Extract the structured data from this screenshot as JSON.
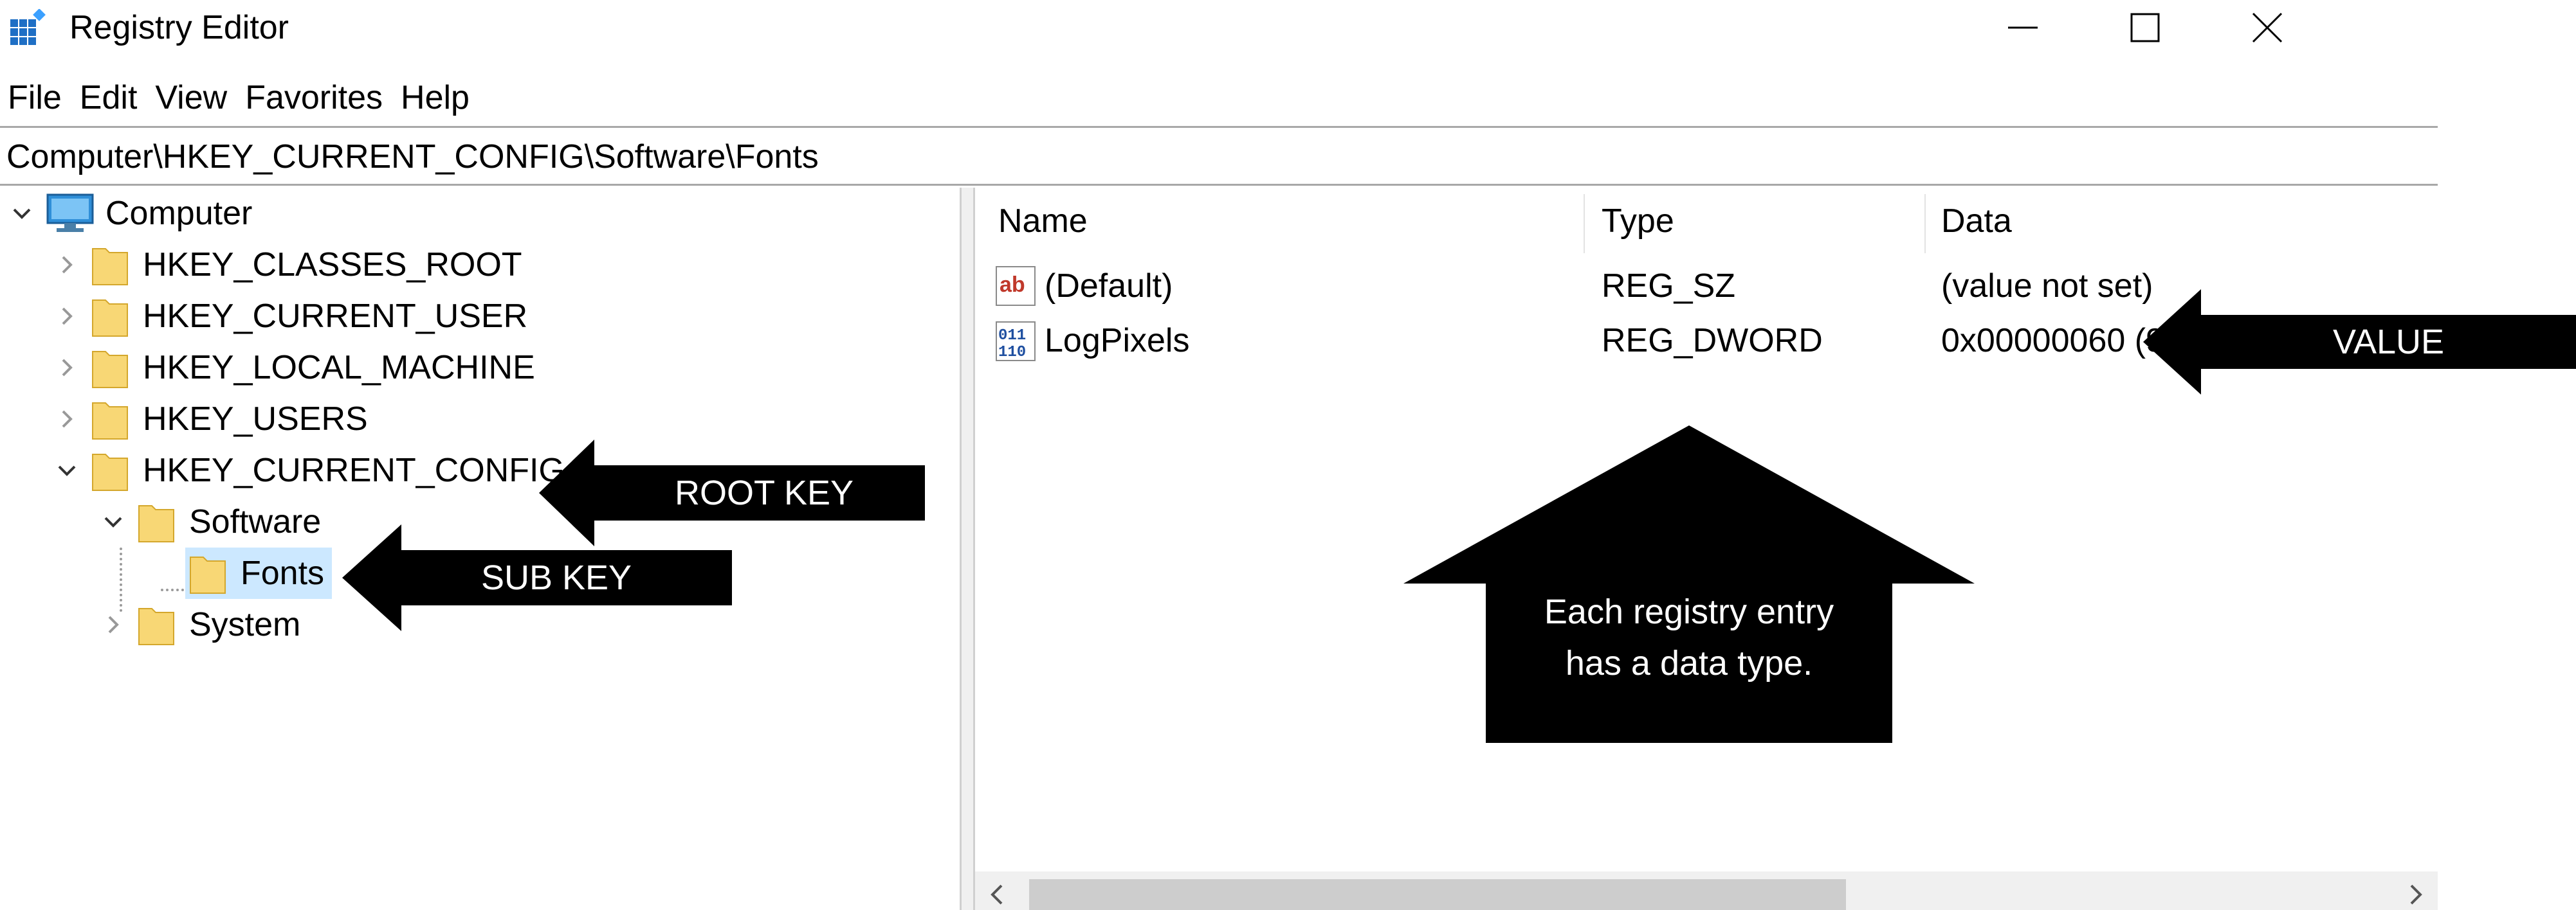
{
  "window": {
    "title": "Registry Editor",
    "controls": [
      "minimize",
      "maximize",
      "close"
    ]
  },
  "menu": [
    "File",
    "Edit",
    "View",
    "Favorites",
    "Help"
  ],
  "address": "Computer\\HKEY_CURRENT_CONFIG\\Software\\Fonts",
  "tree": {
    "root": "Computer",
    "items": [
      {
        "label": "HKEY_CLASSES_ROOT",
        "expanded": false
      },
      {
        "label": "HKEY_CURRENT_USER",
        "expanded": false
      },
      {
        "label": "HKEY_LOCAL_MACHINE",
        "expanded": false
      },
      {
        "label": "HKEY_USERS",
        "expanded": false
      },
      {
        "label": "HKEY_CURRENT_CONFIG",
        "expanded": true
      },
      {
        "label": "Software",
        "expanded": true
      },
      {
        "label": "Fonts",
        "selected": true
      },
      {
        "label": "System",
        "expanded": false
      }
    ]
  },
  "list": {
    "columns": [
      "Name",
      "Type",
      "Data"
    ],
    "rows": [
      {
        "name": "(Default)",
        "type": "REG_SZ",
        "data": "(value not set)",
        "icon": "string-value-icon"
      },
      {
        "name": "LogPixels",
        "type": "REG_DWORD",
        "data": "0x00000060 (96)",
        "icon": "binary-value-icon"
      }
    ]
  },
  "annotations": {
    "root_key": "ROOT KEY",
    "sub_key": "SUB KEY",
    "value": "VALUE",
    "data_type_line1": "Each registry entry",
    "data_type_line2": "has a data type."
  },
  "colors": {
    "selection": "#cce8ff",
    "folder": "#f8d775",
    "annotation": "#000000",
    "separator": "#a8a8a8"
  }
}
